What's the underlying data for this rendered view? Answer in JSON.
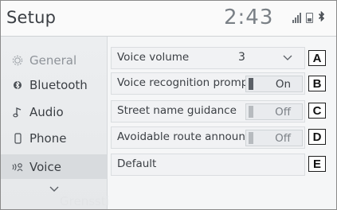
{
  "header": {
    "title": "Setup",
    "time": "2:43",
    "bt_status_glyph": "ʙ"
  },
  "sidebar": {
    "items": [
      {
        "label": "General",
        "icon": "gear-icon"
      },
      {
        "label": "Bluetooth",
        "icon": "bluetooth-icon"
      },
      {
        "label": "Audio",
        "icon": "music-note-icon"
      },
      {
        "label": "Phone",
        "icon": "phone-icon"
      },
      {
        "label": "Voice",
        "icon": "voice-icon",
        "active": true
      }
    ],
    "scroll_down_icon": "chevron-down-icon"
  },
  "settings": {
    "voice_volume": {
      "label": "Voice volume",
      "value": "3",
      "callout": "A"
    },
    "voice_recognition_prompts": {
      "label": "Voice recognition prompts",
      "state": "On",
      "callout": "B"
    },
    "street_name_guidance": {
      "label": "Street name guidance",
      "state": "Off",
      "callout": "C"
    },
    "avoidable_route_announcement": {
      "label": "Avoidable route announcement",
      "state": "Off",
      "callout": "D"
    },
    "default": {
      "label": "Default",
      "callout": "E"
    }
  },
  "watermark": "Grenssti",
  "colors": {
    "accent_dark": "#5b6066",
    "text": "#3b3f44"
  }
}
